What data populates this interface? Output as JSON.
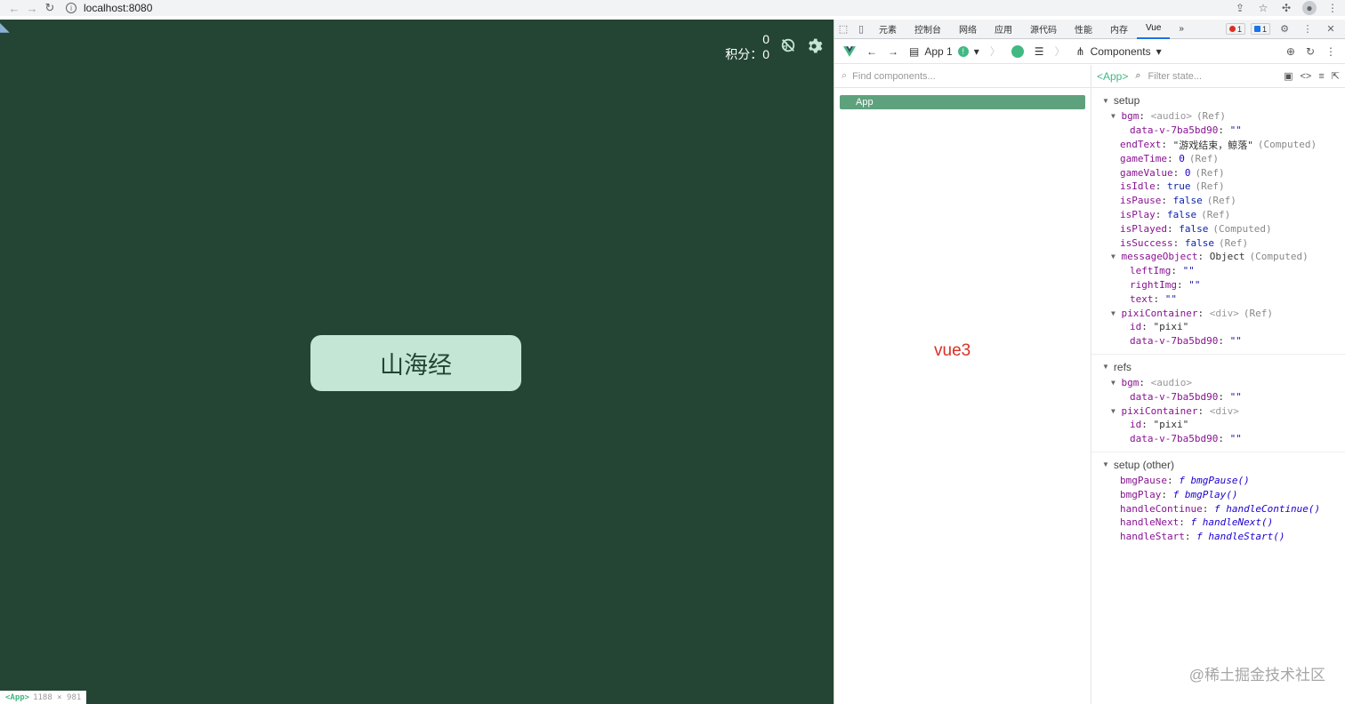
{
  "browser": {
    "url": "localhost:8080"
  },
  "game": {
    "score_top": "0",
    "score_label": "积分：0",
    "start_button": "山海经"
  },
  "inspect_tag": {
    "component": "<App>",
    "size": "1188 × 981"
  },
  "devtools": {
    "tabs": [
      "元素",
      "控制台",
      "网络",
      "应用",
      "源代码",
      "性能",
      "内存",
      "Vue"
    ],
    "more": "»",
    "error_count": "1",
    "message_count": "1",
    "toolbar": {
      "app": "App 1",
      "warn": "!",
      "view": "Components"
    },
    "find_placeholder": "Find components...",
    "tree_root": "App",
    "annotation": "vue3",
    "state_component": "<App>",
    "filter_placeholder": "Filter state...",
    "sections": {
      "setup": {
        "title": "setup",
        "props": [
          {
            "key": "bgm",
            "value": "<audio>",
            "note": "(Ref)"
          },
          {
            "key": "data-v-7ba5bd90",
            "value": "\"\""
          },
          {
            "key": "endText",
            "value": "\"游戏结束，鲸落\"",
            "note": "(Computed)"
          },
          {
            "key": "gameTime",
            "value": "0",
            "note": "(Ref)"
          },
          {
            "key": "gameValue",
            "value": "0",
            "note": "(Ref)"
          },
          {
            "key": "isIdle",
            "value": "true",
            "note": "(Ref)"
          },
          {
            "key": "isPause",
            "value": "false",
            "note": "(Ref)"
          },
          {
            "key": "isPlay",
            "value": "false",
            "note": "(Ref)"
          },
          {
            "key": "isPlayed",
            "value": "false",
            "note": "(Computed)"
          },
          {
            "key": "isSuccess",
            "value": "false",
            "note": "(Ref)"
          },
          {
            "key": "messageObject",
            "value": "Object",
            "note": "(Computed)"
          },
          {
            "key": "leftImg",
            "value": "\"\""
          },
          {
            "key": "rightImg",
            "value": "\"\""
          },
          {
            "key": "text",
            "value": "\"\""
          },
          {
            "key": "pixiContainer",
            "value": "<div>",
            "note": "(Ref)"
          },
          {
            "key": "id",
            "value": "\"pixi\""
          },
          {
            "key": "data-v-7ba5bd90",
            "value": "\"\""
          }
        ]
      },
      "refs": {
        "title": "refs",
        "props": [
          {
            "key": "bgm",
            "value": "<audio>"
          },
          {
            "key": "data-v-7ba5bd90",
            "value": "\"\""
          },
          {
            "key": "pixiContainer",
            "value": "<div>"
          },
          {
            "key": "id",
            "value": "\"pixi\""
          },
          {
            "key": "data-v-7ba5bd90",
            "value": "\"\""
          }
        ]
      },
      "other": {
        "title": "setup (other)",
        "props": [
          {
            "key": "bmgPause",
            "value": "f bmgPause()"
          },
          {
            "key": "bmgPlay",
            "value": "f bmgPlay()"
          },
          {
            "key": "handleContinue",
            "value": "f handleContinue()"
          },
          {
            "key": "handleNext",
            "value": "f handleNext()"
          },
          {
            "key": "handleStart",
            "value": "f handleStart()"
          }
        ]
      }
    },
    "watermark": "@稀土掘金技术社区"
  }
}
